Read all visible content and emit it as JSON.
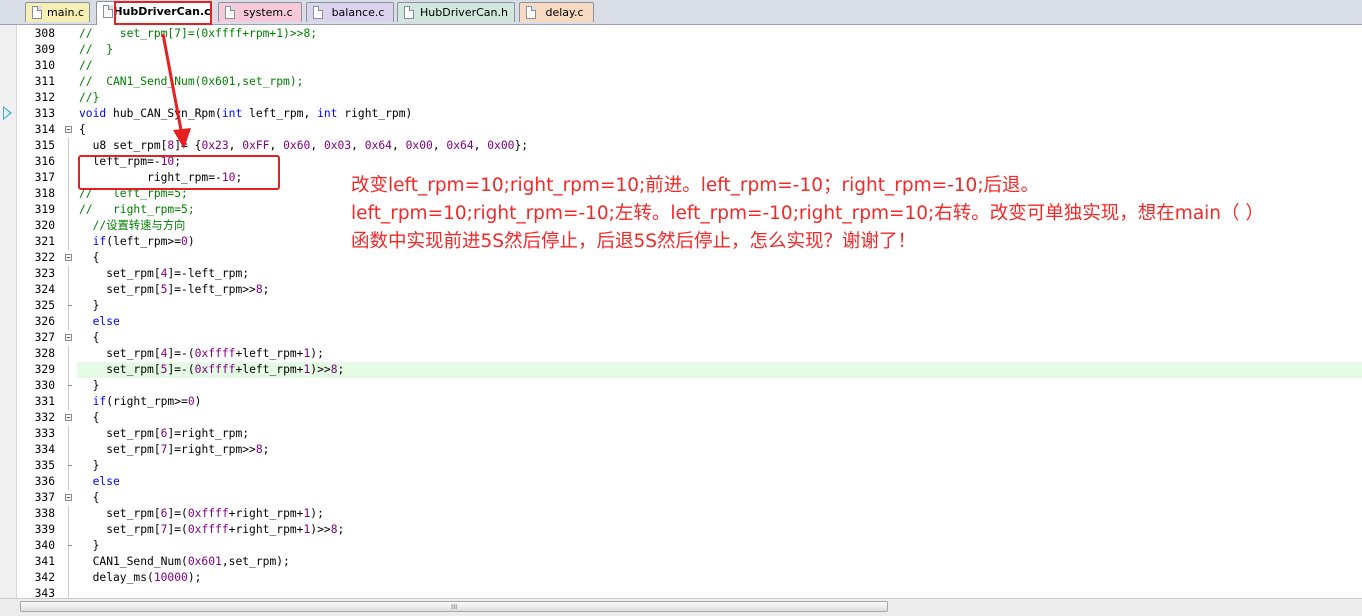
{
  "tabs": [
    {
      "label": "main.c",
      "color": "#f5efb4",
      "active": false
    },
    {
      "label": "HubDriverCan.c",
      "color": "#ffffff",
      "active": true
    },
    {
      "label": "system.c",
      "color": "#f8c9d9",
      "active": false
    },
    {
      "label": "balance.c",
      "color": "#dcd3ef",
      "active": false
    },
    {
      "label": "HubDriverCan.h",
      "color": "#cfe7dc",
      "active": false
    },
    {
      "label": "delay.c",
      "color": "#f8d9c1",
      "active": false
    }
  ],
  "code": {
    "current_line_marker": "313",
    "lines": [
      {
        "n": "308",
        "html": "<span class=\"cm\">//    set_rpm[7]=(0xffff+rpm+1)&gt;&gt;8;</span>"
      },
      {
        "n": "309",
        "html": "<span class=\"cm\">//  }</span>"
      },
      {
        "n": "310",
        "html": "<span class=\"cm\">//</span>"
      },
      {
        "n": "311",
        "html": "<span class=\"cm\">//  CAN1_Send_Num(0x601,set_rpm);</span>"
      },
      {
        "n": "312",
        "html": "<span class=\"cm\">//}</span>"
      },
      {
        "n": "313",
        "html": "<span class=\"kw\">void</span> hub_CAN_Syn_Rpm(<span class=\"kw\">int</span> left_rpm, <span class=\"kw\">int</span> right_rpm)"
      },
      {
        "n": "314",
        "html": "{",
        "fold": "open"
      },
      {
        "n": "315",
        "html": "  u8 set_rpm[<span class=\"num\">8</span>]= {<span class=\"num\">0x23</span>, <span class=\"num\">0xFF</span>, <span class=\"num\">0x60</span>, <span class=\"num\">0x03</span>, <span class=\"num\">0x64</span>, <span class=\"num\">0x00</span>, <span class=\"num\">0x64</span>, <span class=\"num\">0x00</span>};",
        "fold": "bar"
      },
      {
        "n": "316",
        "html": "  left_rpm=-<span class=\"num\">10</span>;",
        "fold": "bar"
      },
      {
        "n": "317",
        "html": "          right_rpm=-<span class=\"num\">10</span>;",
        "fold": "bar"
      },
      {
        "n": "318",
        "html": "<span class=\"cm\">//   left_rpm=5;</span>",
        "fold": "bar"
      },
      {
        "n": "319",
        "html": "<span class=\"cm\">//   right_rpm=5;</span>",
        "fold": "bar"
      },
      {
        "n": "320",
        "html": "  <span class=\"cm\">//设置转速与方向</span>",
        "fold": "bar"
      },
      {
        "n": "321",
        "html": "  <span class=\"kw\">if</span>(left_rpm&gt;=<span class=\"num\">0</span>)",
        "fold": "bar"
      },
      {
        "n": "322",
        "html": "  {",
        "fold": "open"
      },
      {
        "n": "323",
        "html": "    set_rpm[<span class=\"num\">4</span>]=-left_rpm;",
        "fold": "bar"
      },
      {
        "n": "324",
        "html": "    set_rpm[<span class=\"num\">5</span>]=-left_rpm&gt;&gt;<span class=\"num\">8</span>;",
        "fold": "bar"
      },
      {
        "n": "325",
        "html": "  }",
        "fold": "end"
      },
      {
        "n": "326",
        "html": "  <span class=\"kw\">else</span>",
        "fold": "bar"
      },
      {
        "n": "327",
        "html": "  {",
        "fold": "open"
      },
      {
        "n": "328",
        "html": "    set_rpm[<span class=\"num\">4</span>]=-(<span class=\"num\">0xffff</span>+left_rpm+<span class=\"num\">1</span>);",
        "fold": "bar"
      },
      {
        "n": "329",
        "html": "    set_rpm[<span class=\"num\">5</span>]=-(<span class=\"num\">0xffff</span>+left_rpm+<span class=\"num\">1</span>)&gt;&gt;<span class=\"num\">8</span>;",
        "fold": "bar",
        "hl": true
      },
      {
        "n": "330",
        "html": "  }",
        "fold": "end"
      },
      {
        "n": "331",
        "html": "  <span class=\"kw\">if</span>(right_rpm&gt;=<span class=\"num\">0</span>)",
        "fold": "bar"
      },
      {
        "n": "332",
        "html": "  {",
        "fold": "open"
      },
      {
        "n": "333",
        "html": "    set_rpm[<span class=\"num\">6</span>]=right_rpm;",
        "fold": "bar"
      },
      {
        "n": "334",
        "html": "    set_rpm[<span class=\"num\">7</span>]=right_rpm&gt;&gt;<span class=\"num\">8</span>;",
        "fold": "bar"
      },
      {
        "n": "335",
        "html": "  }",
        "fold": "end"
      },
      {
        "n": "336",
        "html": "  <span class=\"kw\">else</span>",
        "fold": "bar"
      },
      {
        "n": "337",
        "html": "  {",
        "fold": "open"
      },
      {
        "n": "338",
        "html": "    set_rpm[<span class=\"num\">6</span>]=(<span class=\"num\">0xffff</span>+right_rpm+<span class=\"num\">1</span>);",
        "fold": "bar"
      },
      {
        "n": "339",
        "html": "    set_rpm[<span class=\"num\">7</span>]=(<span class=\"num\">0xffff</span>+right_rpm+<span class=\"num\">1</span>)&gt;&gt;<span class=\"num\">8</span>;",
        "fold": "bar"
      },
      {
        "n": "340",
        "html": "  }",
        "fold": "end"
      },
      {
        "n": "341",
        "html": "  CAN1_Send_Num(<span class=\"num\">0x601</span>,set_rpm);",
        "fold": "bar"
      },
      {
        "n": "342",
        "html": "  delay_ms(<span class=\"num\">10000</span>);",
        "fold": "bar"
      },
      {
        "n": "343",
        "html": "",
        "fold": "bar"
      }
    ]
  },
  "annotation": {
    "line1": "改变left_rpm=10;right_rpm=10;前进。left_rpm=-10；right_rpm=-10;后退。",
    "line2": "left_rpm=10;right_rpm=-10;左转。left_rpm=-10;right_rpm=10;右转。改变可单独实现，想在main（ ）",
    "line3": "函数中实现前进5S然后停止，后退5S然后停止，怎么实现？谢谢了！",
    "color": "#f52828"
  },
  "scrollbar": {
    "grip": "III"
  }
}
